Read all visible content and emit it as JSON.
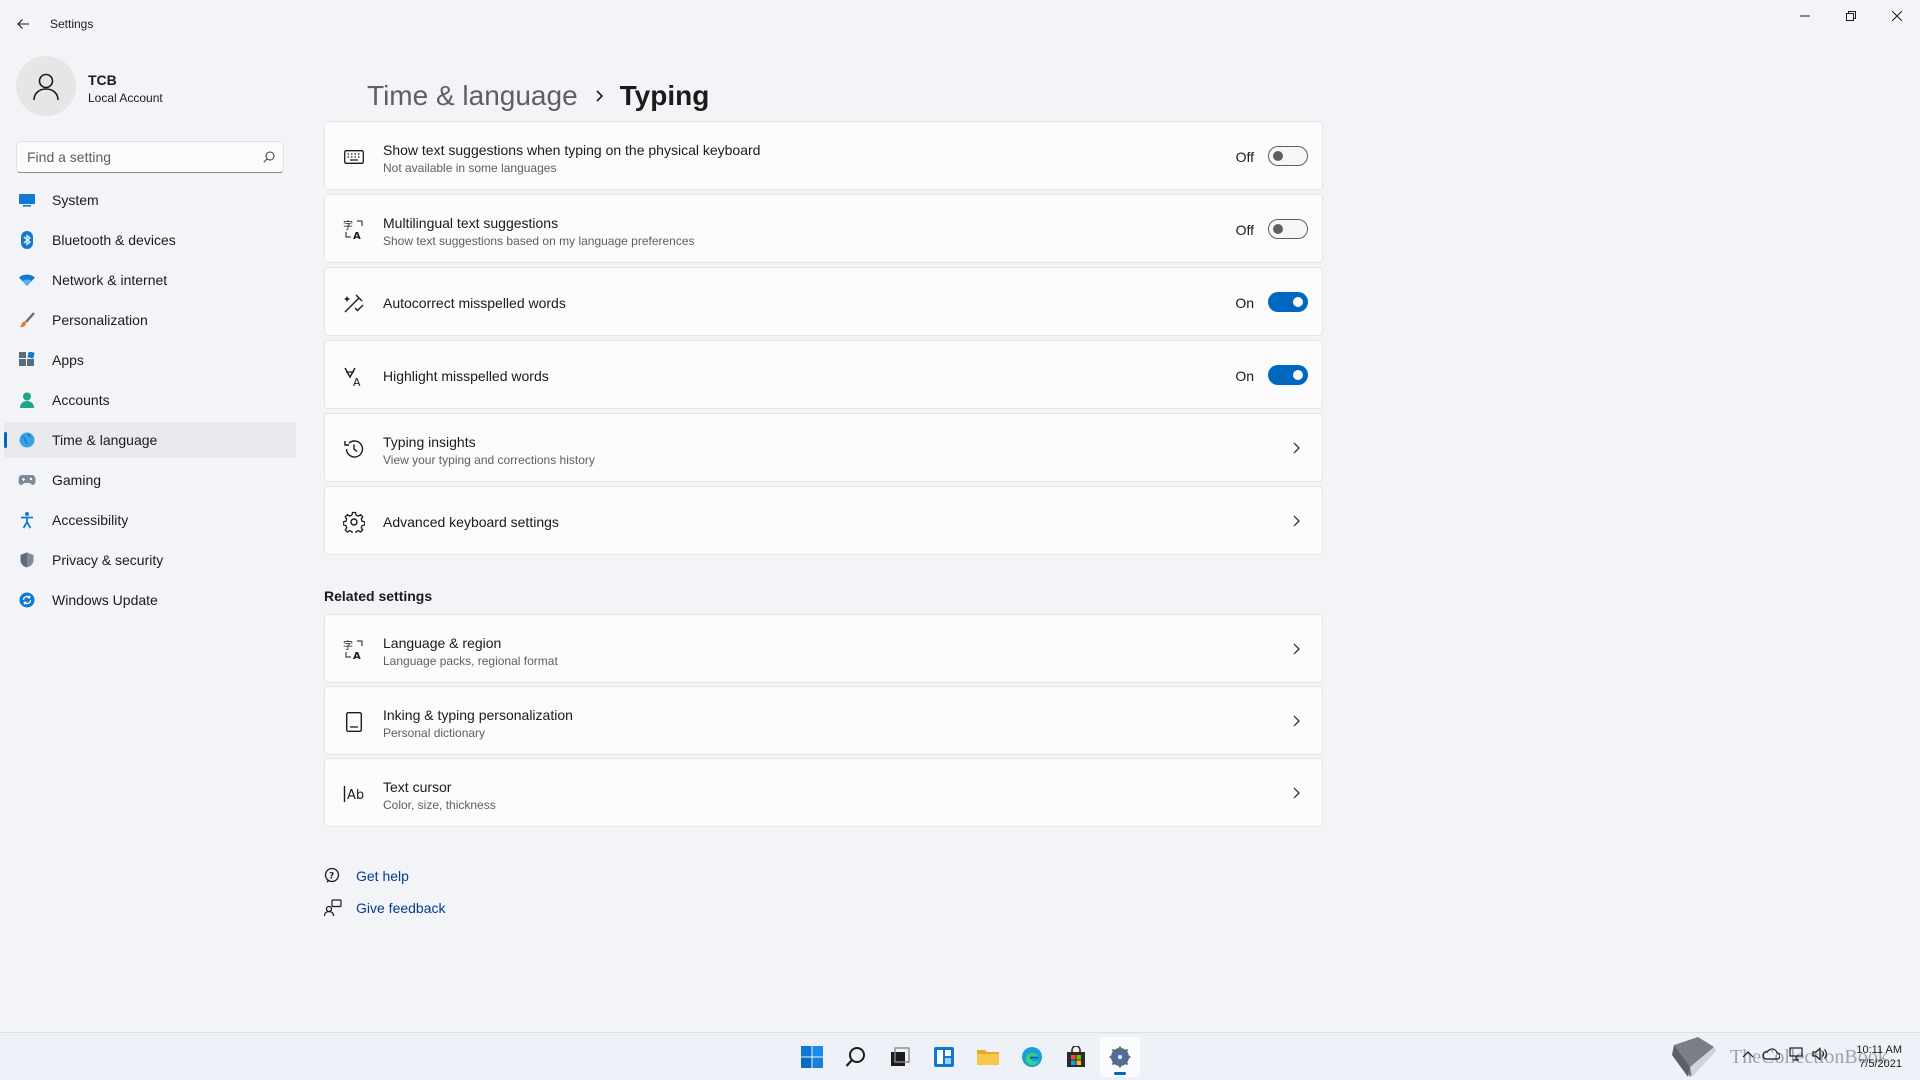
{
  "window": {
    "title": "Settings"
  },
  "profile": {
    "name": "TCB",
    "account_type": "Local Account"
  },
  "search": {
    "placeholder": "Find a setting"
  },
  "sidebar": {
    "items": [
      {
        "label": "System",
        "icon": "system-icon",
        "active": false
      },
      {
        "label": "Bluetooth & devices",
        "icon": "bluetooth-icon",
        "active": false
      },
      {
        "label": "Network & internet",
        "icon": "wifi-icon",
        "active": false
      },
      {
        "label": "Personalization",
        "icon": "brush-icon",
        "active": false
      },
      {
        "label": "Apps",
        "icon": "apps-icon",
        "active": false
      },
      {
        "label": "Accounts",
        "icon": "person-icon",
        "active": false
      },
      {
        "label": "Time & language",
        "icon": "globe-clock-icon",
        "active": true
      },
      {
        "label": "Gaming",
        "icon": "gamepad-icon",
        "active": false
      },
      {
        "label": "Accessibility",
        "icon": "accessibility-icon",
        "active": false
      },
      {
        "label": "Privacy & security",
        "icon": "shield-icon",
        "active": false
      },
      {
        "label": "Windows Update",
        "icon": "update-icon",
        "active": false
      }
    ]
  },
  "breadcrumb": {
    "parent": "Time & language",
    "separator": "›",
    "current": "Typing"
  },
  "settings": [
    {
      "title": "Show text suggestions when typing on the physical keyboard",
      "subtitle": "Not available in some languages",
      "state": "Off",
      "icon": "keyboard-icon"
    },
    {
      "title": "Multilingual text suggestions",
      "subtitle": "Show text suggestions based on my language preferences",
      "state": "Off",
      "icon": "language-icon"
    },
    {
      "title": "Autocorrect misspelled words",
      "subtitle": "",
      "state": "On",
      "icon": "autocorrect-icon"
    },
    {
      "title": "Highlight misspelled words",
      "subtitle": "",
      "state": "On",
      "icon": "spellcheck-icon"
    },
    {
      "title": "Typing insights",
      "subtitle": "View your typing and corrections history",
      "icon": "history-icon"
    },
    {
      "title": "Advanced keyboard settings",
      "subtitle": "",
      "icon": "gear-icon"
    }
  ],
  "related": {
    "heading": "Related settings",
    "items": [
      {
        "title": "Language & region",
        "subtitle": "Language packs, regional format",
        "icon": "language-icon"
      },
      {
        "title": "Inking & typing personalization",
        "subtitle": "Personal dictionary",
        "icon": "notebook-icon"
      },
      {
        "title": "Text cursor",
        "subtitle": "Color, size, thickness",
        "icon": "text-cursor-icon"
      }
    ]
  },
  "help_links": {
    "get_help": "Get help",
    "give_feedback": "Give feedback"
  },
  "taskbar": {
    "apps": [
      "start-icon",
      "search-icon",
      "task-view-icon",
      "widgets-icon",
      "file-explorer-icon",
      "edge-icon",
      "store-icon",
      "settings-icon"
    ],
    "active_app": "settings-icon",
    "watermark": "TheCollectionBook",
    "time": "10:11 AM",
    "date": "7/5/2021"
  },
  "colors": {
    "accent": "#0067c0",
    "background": "#f3f4f7",
    "card": "#fbfbfc",
    "link": "#003e92"
  }
}
